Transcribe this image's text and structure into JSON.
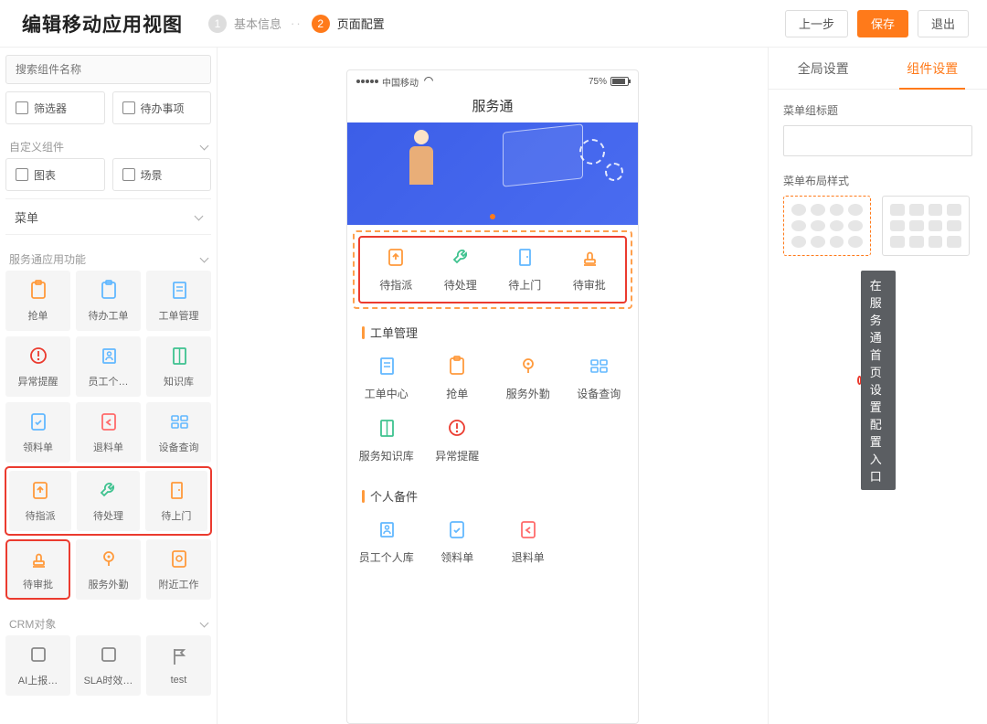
{
  "header": {
    "title": "编辑移动应用视图",
    "steps": [
      {
        "num": "1",
        "label": "基本信息",
        "active": false
      },
      {
        "num": "2",
        "label": "页面配置",
        "active": true
      }
    ],
    "prev": "上一步",
    "save": "保存",
    "exit": "退出"
  },
  "left": {
    "search_placeholder": "搜索组件名称",
    "basic_widgets": [
      "筛选器",
      "待办事项"
    ],
    "custom_group": "自定义组件",
    "custom_widgets": [
      "图表",
      "场景"
    ],
    "menu_label": "菜单",
    "service_group": "服务通应用功能",
    "service_items": [
      {
        "label": "抢单",
        "icon": "clipboard",
        "color": "#ff9a3c"
      },
      {
        "label": "待办工单",
        "icon": "clipboard",
        "color": "#62b8ff"
      },
      {
        "label": "工单管理",
        "icon": "doc",
        "color": "#62b8ff"
      },
      {
        "label": "异常提醒",
        "icon": "alert",
        "color": "#eb3b2f"
      },
      {
        "label": "员工个…",
        "icon": "person",
        "color": "#62b8ff"
      },
      {
        "label": "知识库",
        "icon": "book",
        "color": "#3ec28f"
      },
      {
        "label": "领料单",
        "icon": "doc-check",
        "color": "#62b8ff"
      },
      {
        "label": "退料单",
        "icon": "doc-back",
        "color": "#ff6b6b"
      },
      {
        "label": "设备查询",
        "icon": "grid",
        "color": "#62b8ff"
      }
    ],
    "hl_row": [
      {
        "label": "待指派",
        "icon": "assign",
        "color": "#ff9a3c"
      },
      {
        "label": "待处理",
        "icon": "wrench",
        "color": "#3ec28f"
      },
      {
        "label": "待上门",
        "icon": "door",
        "color": "#ff9a3c"
      }
    ],
    "hl_single": {
      "label": "待审批",
      "icon": "stamp",
      "color": "#ff9a3c"
    },
    "after_items": [
      {
        "label": "服务外勤",
        "icon": "location",
        "color": "#ff9a3c"
      },
      {
        "label": "附近工作",
        "icon": "nearby",
        "color": "#ff9a3c"
      }
    ],
    "crm_group": "CRM对象",
    "crm_items": [
      {
        "label": "AI上报…",
        "icon": "square"
      },
      {
        "label": "SLA时效…",
        "icon": "square"
      },
      {
        "label": "test",
        "icon": "flag"
      }
    ]
  },
  "phone": {
    "carrier": "中国移动",
    "battery": "75%",
    "title": "服务通",
    "selected_row": [
      {
        "label": "待指派",
        "icon": "assign",
        "color": "#ff9a3c"
      },
      {
        "label": "待处理",
        "icon": "wrench",
        "color": "#3ec28f"
      },
      {
        "label": "待上门",
        "icon": "door",
        "color": "#62b8ff"
      },
      {
        "label": "待审批",
        "icon": "stamp",
        "color": "#ff9a3c"
      }
    ],
    "sections": [
      {
        "title": "工单管理",
        "items": [
          {
            "label": "工单中心",
            "icon": "doc",
            "color": "#62b8ff"
          },
          {
            "label": "抢单",
            "icon": "clipboard",
            "color": "#ff9a3c"
          },
          {
            "label": "服务外勤",
            "icon": "location",
            "color": "#ff9a3c"
          },
          {
            "label": "设备查询",
            "icon": "grid",
            "color": "#62b8ff"
          },
          {
            "label": "服务知识库",
            "icon": "book",
            "color": "#3ec28f"
          },
          {
            "label": "异常提醒",
            "icon": "alert",
            "color": "#eb3b2f"
          }
        ]
      },
      {
        "title": "个人备件",
        "items": [
          {
            "label": "员工个人库",
            "icon": "person",
            "color": "#62b8ff"
          },
          {
            "label": "领料单",
            "icon": "doc-check",
            "color": "#62b8ff"
          },
          {
            "label": "退料单",
            "icon": "doc-back",
            "color": "#ff6b6b"
          }
        ]
      }
    ]
  },
  "callout": "在服务通首页设置配置入口",
  "right": {
    "tab_global": "全局设置",
    "tab_component": "组件设置",
    "field_title": "菜单组标题",
    "field_layout": "菜单布局样式"
  }
}
